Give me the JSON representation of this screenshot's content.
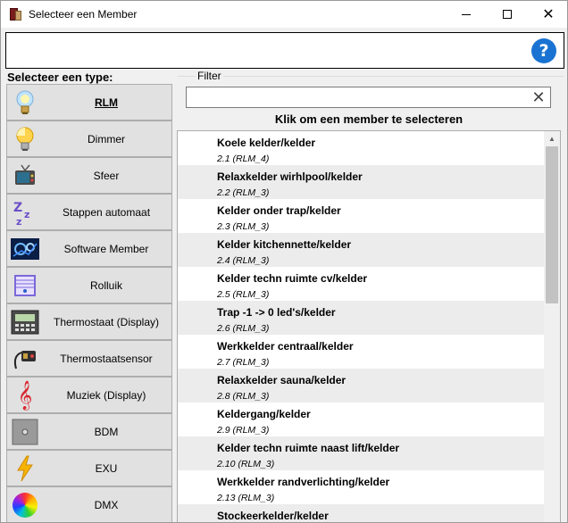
{
  "window": {
    "title": "Selecteer een Member"
  },
  "types": {
    "header": "Selecteer een type:",
    "items": [
      {
        "label": "RLM",
        "icon": "bulb-icon",
        "active": true
      },
      {
        "label": "Dimmer",
        "icon": "dimmer-bulb-icon"
      },
      {
        "label": "Sfeer",
        "icon": "tv-icon"
      },
      {
        "label": "Stappen automaat",
        "icon": "zz-icon"
      },
      {
        "label": "Software Member",
        "icon": "software-chip-icon"
      },
      {
        "label": "Rolluik",
        "icon": "blind-icon"
      },
      {
        "label": "Thermostaat (Display)",
        "icon": "thermostat-display-icon"
      },
      {
        "label": "Thermostaatsensor",
        "icon": "sensor-icon"
      },
      {
        "label": "Muziek (Display)",
        "icon": "music-clef-icon"
      },
      {
        "label": "BDM",
        "icon": "bdm-icon"
      },
      {
        "label": "EXU",
        "icon": "lightning-icon"
      },
      {
        "label": "DMX",
        "icon": "color-wheel-icon"
      }
    ]
  },
  "filter": {
    "label": "Filter",
    "value": ""
  },
  "list": {
    "heading": "Klik om een member te selecteren",
    "items": [
      {
        "name": "Koele kelder/kelder",
        "sub": "2.1 (RLM_4)"
      },
      {
        "name": "Relaxkelder wirhlpool/kelder",
        "sub": "2.2 (RLM_3)"
      },
      {
        "name": "Kelder onder trap/kelder",
        "sub": "2.3 (RLM_3)"
      },
      {
        "name": "Kelder kitchennette/kelder",
        "sub": "2.4 (RLM_3)"
      },
      {
        "name": "Kelder techn ruimte cv/kelder",
        "sub": "2.5 (RLM_3)"
      },
      {
        "name": "Trap -1 -> 0 led's/kelder",
        "sub": "2.6 (RLM_3)"
      },
      {
        "name": "Werkkelder centraal/kelder",
        "sub": "2.7 (RLM_3)"
      },
      {
        "name": "Relaxkelder sauna/kelder",
        "sub": "2.8 (RLM_3)"
      },
      {
        "name": "Keldergang/kelder",
        "sub": "2.9 (RLM_3)"
      },
      {
        "name": "Kelder techn ruimte naast lift/kelder",
        "sub": "2.10 (RLM_3)"
      },
      {
        "name": "Werkkelder randverlichting/kelder",
        "sub": "2.13 (RLM_3)"
      },
      {
        "name": "Stockeerkelder/kelder",
        "sub": ""
      }
    ]
  }
}
